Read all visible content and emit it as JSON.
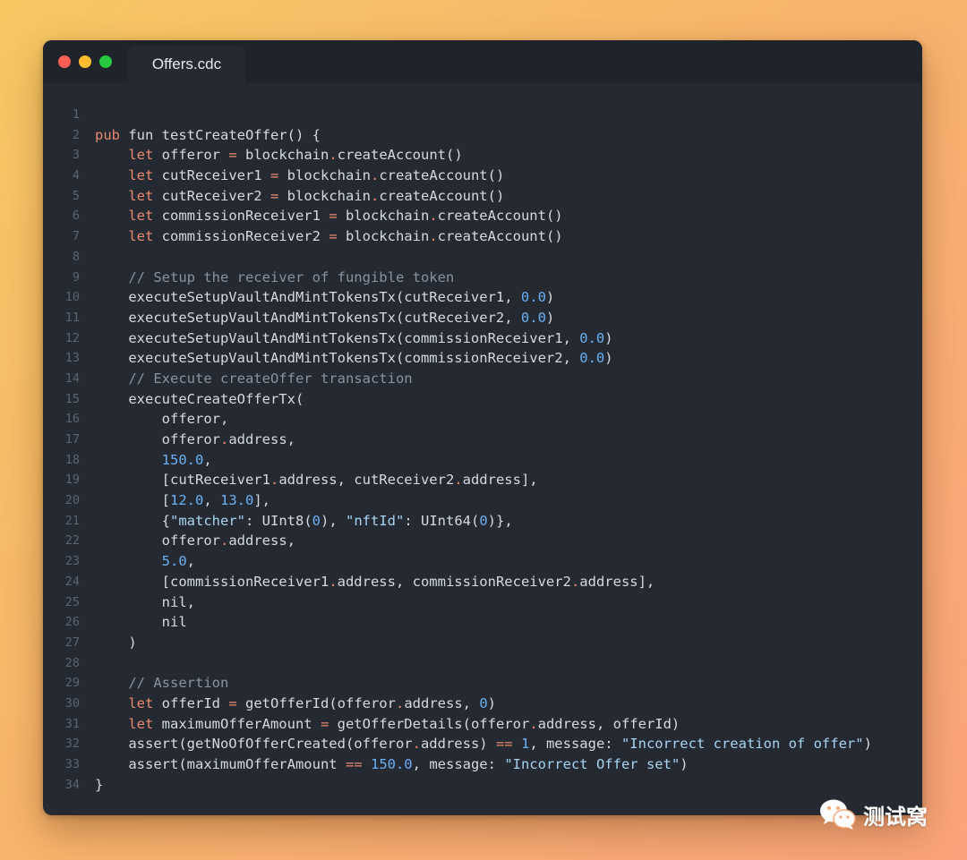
{
  "window": {
    "tab_label": "Offers.cdc"
  },
  "colors": {
    "background_gradient": [
      "#f6c862",
      "#f9a37a"
    ],
    "editor_bg": "#242932",
    "titlebar_bg": "#1f232a",
    "keyword": "#e98a6e",
    "number": "#6ab0f3",
    "string": "#a8d4f0",
    "comment": "#8a929d",
    "text": "#d5dae1",
    "line_number": "#5c6470",
    "traffic_red": "#ff5f57",
    "traffic_yellow": "#febc2e",
    "traffic_green": "#28c840"
  },
  "code_lines": [
    {
      "n": "1",
      "tokens": []
    },
    {
      "n": "2",
      "tokens": [
        [
          "kw",
          "pub"
        ],
        [
          "txt",
          " fun testCreateOffer() {"
        ]
      ]
    },
    {
      "n": "3",
      "tokens": [
        [
          "txt",
          "    "
        ],
        [
          "kw",
          "let"
        ],
        [
          "txt",
          " offeror "
        ],
        [
          "kw",
          "="
        ],
        [
          "txt",
          " blockchain"
        ],
        [
          "kw",
          "."
        ],
        [
          "txt",
          "createAccount()"
        ]
      ]
    },
    {
      "n": "4",
      "tokens": [
        [
          "txt",
          "    "
        ],
        [
          "kw",
          "let"
        ],
        [
          "txt",
          " cutReceiver1 "
        ],
        [
          "kw",
          "="
        ],
        [
          "txt",
          " blockchain"
        ],
        [
          "kw",
          "."
        ],
        [
          "txt",
          "createAccount()"
        ]
      ]
    },
    {
      "n": "5",
      "tokens": [
        [
          "txt",
          "    "
        ],
        [
          "kw",
          "let"
        ],
        [
          "txt",
          " cutReceiver2 "
        ],
        [
          "kw",
          "="
        ],
        [
          "txt",
          " blockchain"
        ],
        [
          "kw",
          "."
        ],
        [
          "txt",
          "createAccount()"
        ]
      ]
    },
    {
      "n": "6",
      "tokens": [
        [
          "txt",
          "    "
        ],
        [
          "kw",
          "let"
        ],
        [
          "txt",
          " commissionReceiver1 "
        ],
        [
          "kw",
          "="
        ],
        [
          "txt",
          " blockchain"
        ],
        [
          "kw",
          "."
        ],
        [
          "txt",
          "createAccount()"
        ]
      ]
    },
    {
      "n": "7",
      "tokens": [
        [
          "txt",
          "    "
        ],
        [
          "kw",
          "let"
        ],
        [
          "txt",
          " commissionReceiver2 "
        ],
        [
          "kw",
          "="
        ],
        [
          "txt",
          " blockchain"
        ],
        [
          "kw",
          "."
        ],
        [
          "txt",
          "createAccount()"
        ]
      ]
    },
    {
      "n": "8",
      "tokens": []
    },
    {
      "n": "9",
      "tokens": [
        [
          "txt",
          "    "
        ],
        [
          "com",
          "// Setup the receiver of fungible token"
        ]
      ]
    },
    {
      "n": "10",
      "tokens": [
        [
          "txt",
          "    executeSetupVaultAndMintTokensTx(cutReceiver1, "
        ],
        [
          "num",
          "0.0"
        ],
        [
          "txt",
          ")"
        ]
      ]
    },
    {
      "n": "11",
      "tokens": [
        [
          "txt",
          "    executeSetupVaultAndMintTokensTx(cutReceiver2, "
        ],
        [
          "num",
          "0.0"
        ],
        [
          "txt",
          ")"
        ]
      ]
    },
    {
      "n": "12",
      "tokens": [
        [
          "txt",
          "    executeSetupVaultAndMintTokensTx(commissionReceiver1, "
        ],
        [
          "num",
          "0.0"
        ],
        [
          "txt",
          ")"
        ]
      ]
    },
    {
      "n": "13",
      "tokens": [
        [
          "txt",
          "    executeSetupVaultAndMintTokensTx(commissionReceiver2, "
        ],
        [
          "num",
          "0.0"
        ],
        [
          "txt",
          ")"
        ]
      ]
    },
    {
      "n": "14",
      "tokens": [
        [
          "txt",
          "    "
        ],
        [
          "com",
          "// Execute createOffer transaction"
        ]
      ]
    },
    {
      "n": "15",
      "tokens": [
        [
          "txt",
          "    executeCreateOfferTx("
        ]
      ]
    },
    {
      "n": "16",
      "tokens": [
        [
          "txt",
          "        offeror,"
        ]
      ]
    },
    {
      "n": "17",
      "tokens": [
        [
          "txt",
          "        offeror"
        ],
        [
          "kw",
          "."
        ],
        [
          "txt",
          "address,"
        ]
      ]
    },
    {
      "n": "18",
      "tokens": [
        [
          "txt",
          "        "
        ],
        [
          "num",
          "150.0"
        ],
        [
          "txt",
          ","
        ]
      ]
    },
    {
      "n": "19",
      "tokens": [
        [
          "txt",
          "        [cutReceiver1"
        ],
        [
          "kw",
          "."
        ],
        [
          "txt",
          "address, cutReceiver2"
        ],
        [
          "kw",
          "."
        ],
        [
          "txt",
          "address],"
        ]
      ]
    },
    {
      "n": "20",
      "tokens": [
        [
          "txt",
          "        ["
        ],
        [
          "num",
          "12.0"
        ],
        [
          "txt",
          ", "
        ],
        [
          "num",
          "13.0"
        ],
        [
          "txt",
          "],"
        ]
      ]
    },
    {
      "n": "21",
      "tokens": [
        [
          "txt",
          "        {"
        ],
        [
          "str",
          "\"matcher\""
        ],
        [
          "txt",
          ": UInt8("
        ],
        [
          "num",
          "0"
        ],
        [
          "txt",
          "), "
        ],
        [
          "str",
          "\"nftId\""
        ],
        [
          "txt",
          ": UInt64("
        ],
        [
          "num",
          "0"
        ],
        [
          "txt",
          ")},"
        ]
      ]
    },
    {
      "n": "22",
      "tokens": [
        [
          "txt",
          "        offeror"
        ],
        [
          "kw",
          "."
        ],
        [
          "txt",
          "address,"
        ]
      ]
    },
    {
      "n": "23",
      "tokens": [
        [
          "txt",
          "        "
        ],
        [
          "num",
          "5.0"
        ],
        [
          "txt",
          ","
        ]
      ]
    },
    {
      "n": "24",
      "tokens": [
        [
          "txt",
          "        [commissionReceiver1"
        ],
        [
          "kw",
          "."
        ],
        [
          "txt",
          "address, commissionReceiver2"
        ],
        [
          "kw",
          "."
        ],
        [
          "txt",
          "address],"
        ]
      ]
    },
    {
      "n": "25",
      "tokens": [
        [
          "txt",
          "        nil,"
        ]
      ]
    },
    {
      "n": "26",
      "tokens": [
        [
          "txt",
          "        nil"
        ]
      ]
    },
    {
      "n": "27",
      "tokens": [
        [
          "txt",
          "    )"
        ]
      ]
    },
    {
      "n": "28",
      "tokens": []
    },
    {
      "n": "29",
      "tokens": [
        [
          "txt",
          "    "
        ],
        [
          "com",
          "// Assertion"
        ]
      ]
    },
    {
      "n": "30",
      "tokens": [
        [
          "txt",
          "    "
        ],
        [
          "kw",
          "let"
        ],
        [
          "txt",
          " offerId "
        ],
        [
          "kw",
          "="
        ],
        [
          "txt",
          " getOfferId(offeror"
        ],
        [
          "kw",
          "."
        ],
        [
          "txt",
          "address, "
        ],
        [
          "num",
          "0"
        ],
        [
          "txt",
          ")"
        ]
      ]
    },
    {
      "n": "31",
      "tokens": [
        [
          "txt",
          "    "
        ],
        [
          "kw",
          "let"
        ],
        [
          "txt",
          " maximumOfferAmount "
        ],
        [
          "kw",
          "="
        ],
        [
          "txt",
          " getOfferDetails(offeror"
        ],
        [
          "kw",
          "."
        ],
        [
          "txt",
          "address, offerId)"
        ]
      ]
    },
    {
      "n": "32",
      "tokens": [
        [
          "txt",
          "    assert(getNoOfOfferCreated(offeror"
        ],
        [
          "kw",
          "."
        ],
        [
          "txt",
          "address) "
        ],
        [
          "kw",
          "=="
        ],
        [
          "txt",
          " "
        ],
        [
          "num",
          "1"
        ],
        [
          "txt",
          ", message: "
        ],
        [
          "str",
          "\"Incorrect creation of offer\""
        ],
        [
          "txt",
          ")"
        ]
      ]
    },
    {
      "n": "33",
      "tokens": [
        [
          "txt",
          "    assert(maximumOfferAmount "
        ],
        [
          "kw",
          "=="
        ],
        [
          "txt",
          " "
        ],
        [
          "num",
          "150.0"
        ],
        [
          "txt",
          ", message: "
        ],
        [
          "str",
          "\"Incorrect Offer set\""
        ],
        [
          "txt",
          ")"
        ]
      ]
    },
    {
      "n": "34",
      "tokens": [
        [
          "txt",
          "}"
        ]
      ]
    }
  ],
  "watermark": {
    "icon": "wechat-icon",
    "text": "测试窝"
  }
}
